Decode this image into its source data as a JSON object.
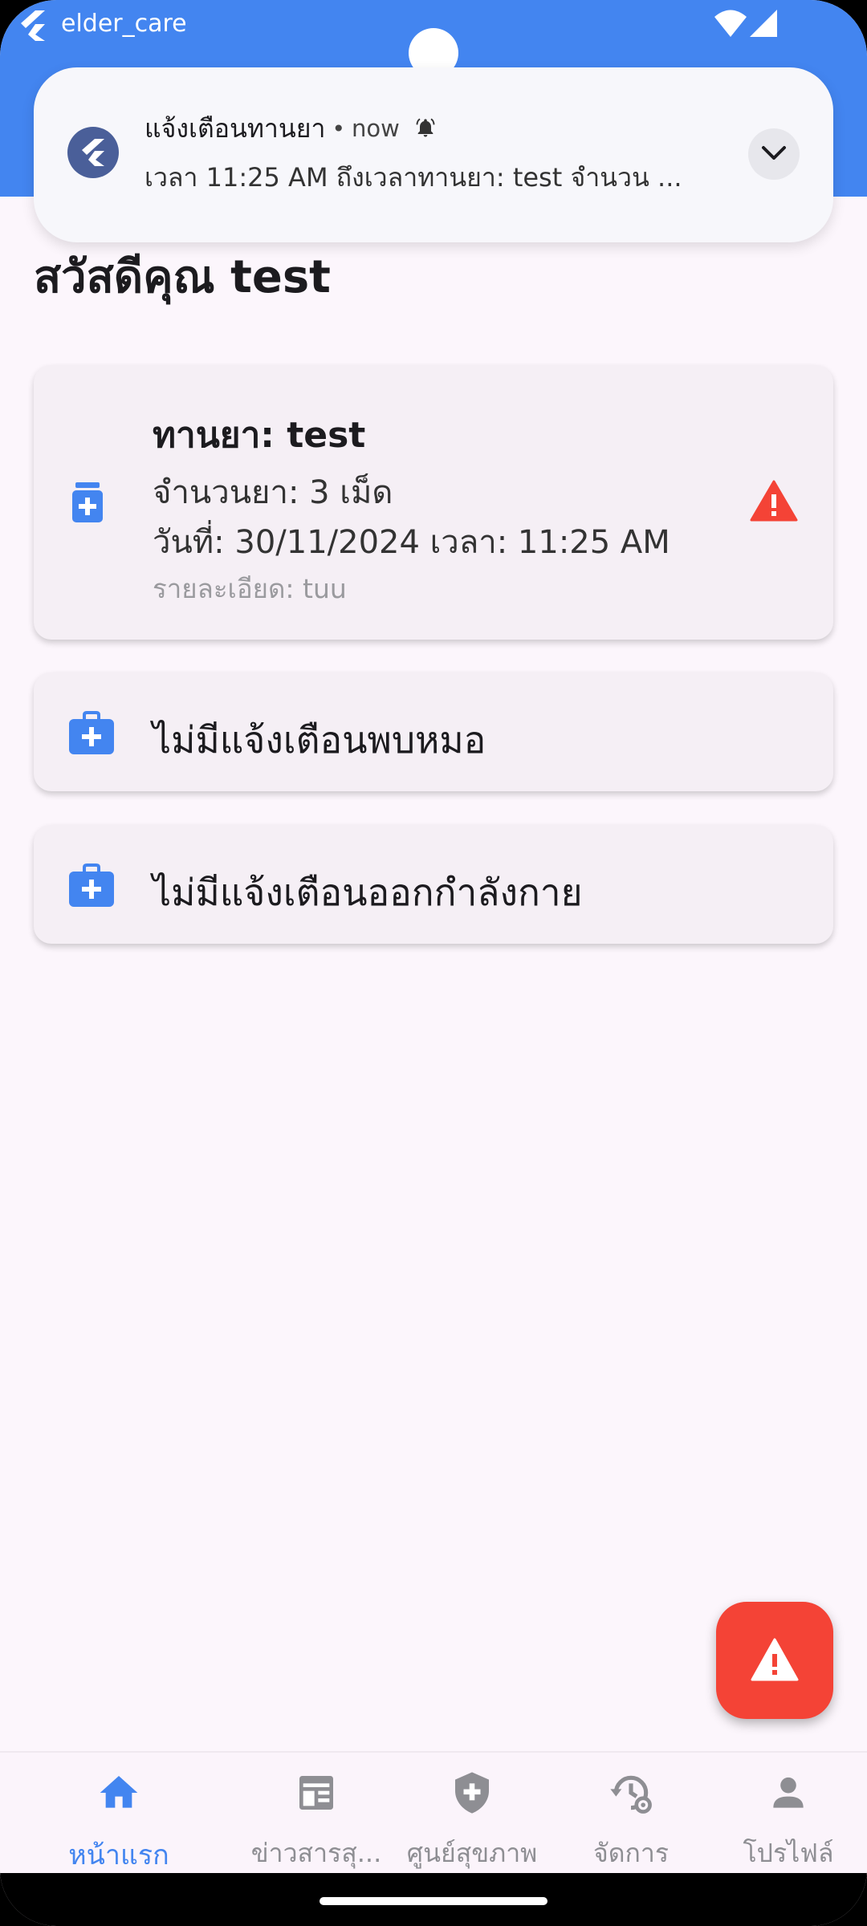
{
  "status_bar": {
    "app_name": "elder_care"
  },
  "notification": {
    "title": "แจ้งเตือนทานยา",
    "time": "now",
    "body": "เวลา 11:25 AM ถึงเวลาทานยา: test จำนวน ...",
    "icon": "flutter-logo-icon",
    "expand_icon": "chevron-down-icon"
  },
  "greeting": "สวัสดีคุณ test",
  "medicine_card": {
    "title": "ทานยา: test",
    "quantity": "จำนวนยา: 3 เม็ด",
    "date_time": "วันที่: 30/11/2024 เวลา: 11:25 AM",
    "detail": "รายละเอียด: tuu",
    "icon": "medication-icon",
    "status_icon": "warning-icon"
  },
  "doctor_card": {
    "text": "ไม่มีแจ้งเตือนพบหมอ",
    "icon": "medical-bag-icon"
  },
  "exercise_card": {
    "text": "ไม่มีแจ้งเตือนออกกำลังกาย",
    "icon": "medical-bag-icon"
  },
  "fab": {
    "icon": "warning-icon"
  },
  "bottom_nav": {
    "items": [
      {
        "label": "หน้าแรก",
        "icon": "home-icon",
        "active": true
      },
      {
        "label": "ข่าวสารสุ...",
        "icon": "newspaper-icon",
        "active": false
      },
      {
        "label": "ศูนย์สุขภาพ",
        "icon": "health-shield-icon",
        "active": false
      },
      {
        "label": "จัดการ",
        "icon": "manage-history-icon",
        "active": false
      },
      {
        "label": "โปรไฟล์",
        "icon": "person-icon",
        "active": false
      }
    ]
  },
  "colors": {
    "primary": "#4385F0",
    "warning": "#F44336",
    "background": "#FCF6FC",
    "card": "#F5EFF5"
  }
}
